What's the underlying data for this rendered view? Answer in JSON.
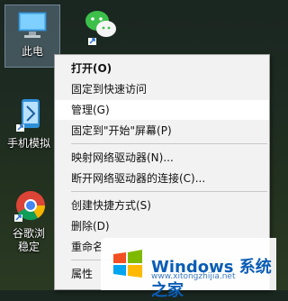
{
  "desktop": {
    "icons": [
      {
        "label": "此电",
        "name": "this-pc"
      },
      {
        "label": "",
        "name": "wechat"
      },
      {
        "label": "手机模拟",
        "name": "phone-emulator"
      },
      {
        "label": "谷歌浏",
        "name": "chrome"
      },
      {
        "label": "稳定",
        "name": "chrome-line2"
      }
    ]
  },
  "context_menu": {
    "items": [
      {
        "label": "打开(O)",
        "bold": true
      },
      {
        "label": "固定到快速访问"
      },
      {
        "label": "管理(G)",
        "highlighted": true
      },
      {
        "label": "固定到\"开始\"屏幕(P)"
      },
      {
        "label": "映射网络驱动器(N)..."
      },
      {
        "label": "断开网络驱动器的连接(C)..."
      },
      {
        "label": "创建快捷方式(S)"
      },
      {
        "label": "删除(D)"
      },
      {
        "label": "重命名"
      },
      {
        "label": "属性"
      }
    ]
  },
  "watermark": {
    "brand": "Windows",
    "cn": "系统之家",
    "url": "www.xitongzhijia.net"
  },
  "colors": {
    "menu_bg": "#f2f2f2",
    "menu_hover": "#ffffff",
    "watermark_blue": "#0a5db5"
  }
}
